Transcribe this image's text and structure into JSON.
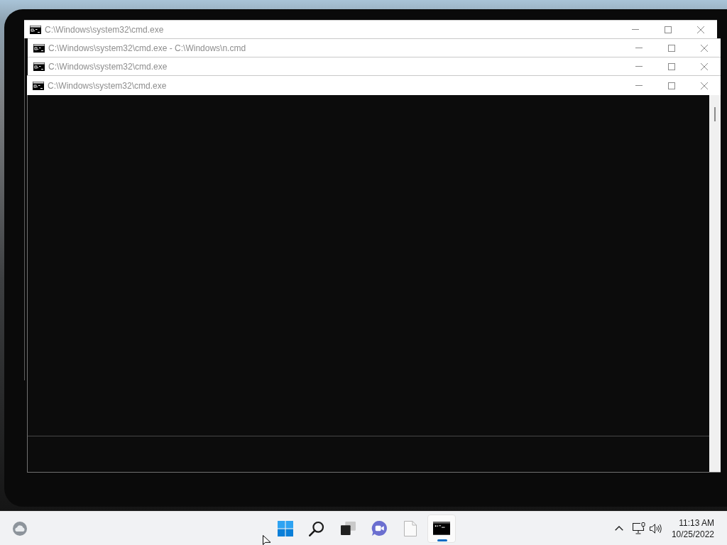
{
  "windows": [
    {
      "kind": "titlebar",
      "title": "C:\\Windows\\system32\\cmd.exe"
    },
    {
      "kind": "titlebar",
      "title": "C:\\Windows\\system32\\cmd.exe - C:\\Windows\\n.cmd"
    },
    {
      "kind": "titlebar",
      "title": "C:\\Windows\\system32\\cmd.exe"
    },
    {
      "kind": "console",
      "title": "C:\\Windows\\system32\\cmd.exe"
    }
  ],
  "taskbar": {
    "apps": [
      {
        "kind": "start",
        "selected": false
      },
      {
        "kind": "search",
        "selected": false
      },
      {
        "kind": "taskview",
        "selected": false
      },
      {
        "kind": "chat",
        "selected": false
      },
      {
        "kind": "file",
        "selected": false
      },
      {
        "kind": "terminal",
        "selected": true
      }
    ],
    "clock": {
      "time": "11:13 AM",
      "date": "10/25/2022"
    }
  }
}
